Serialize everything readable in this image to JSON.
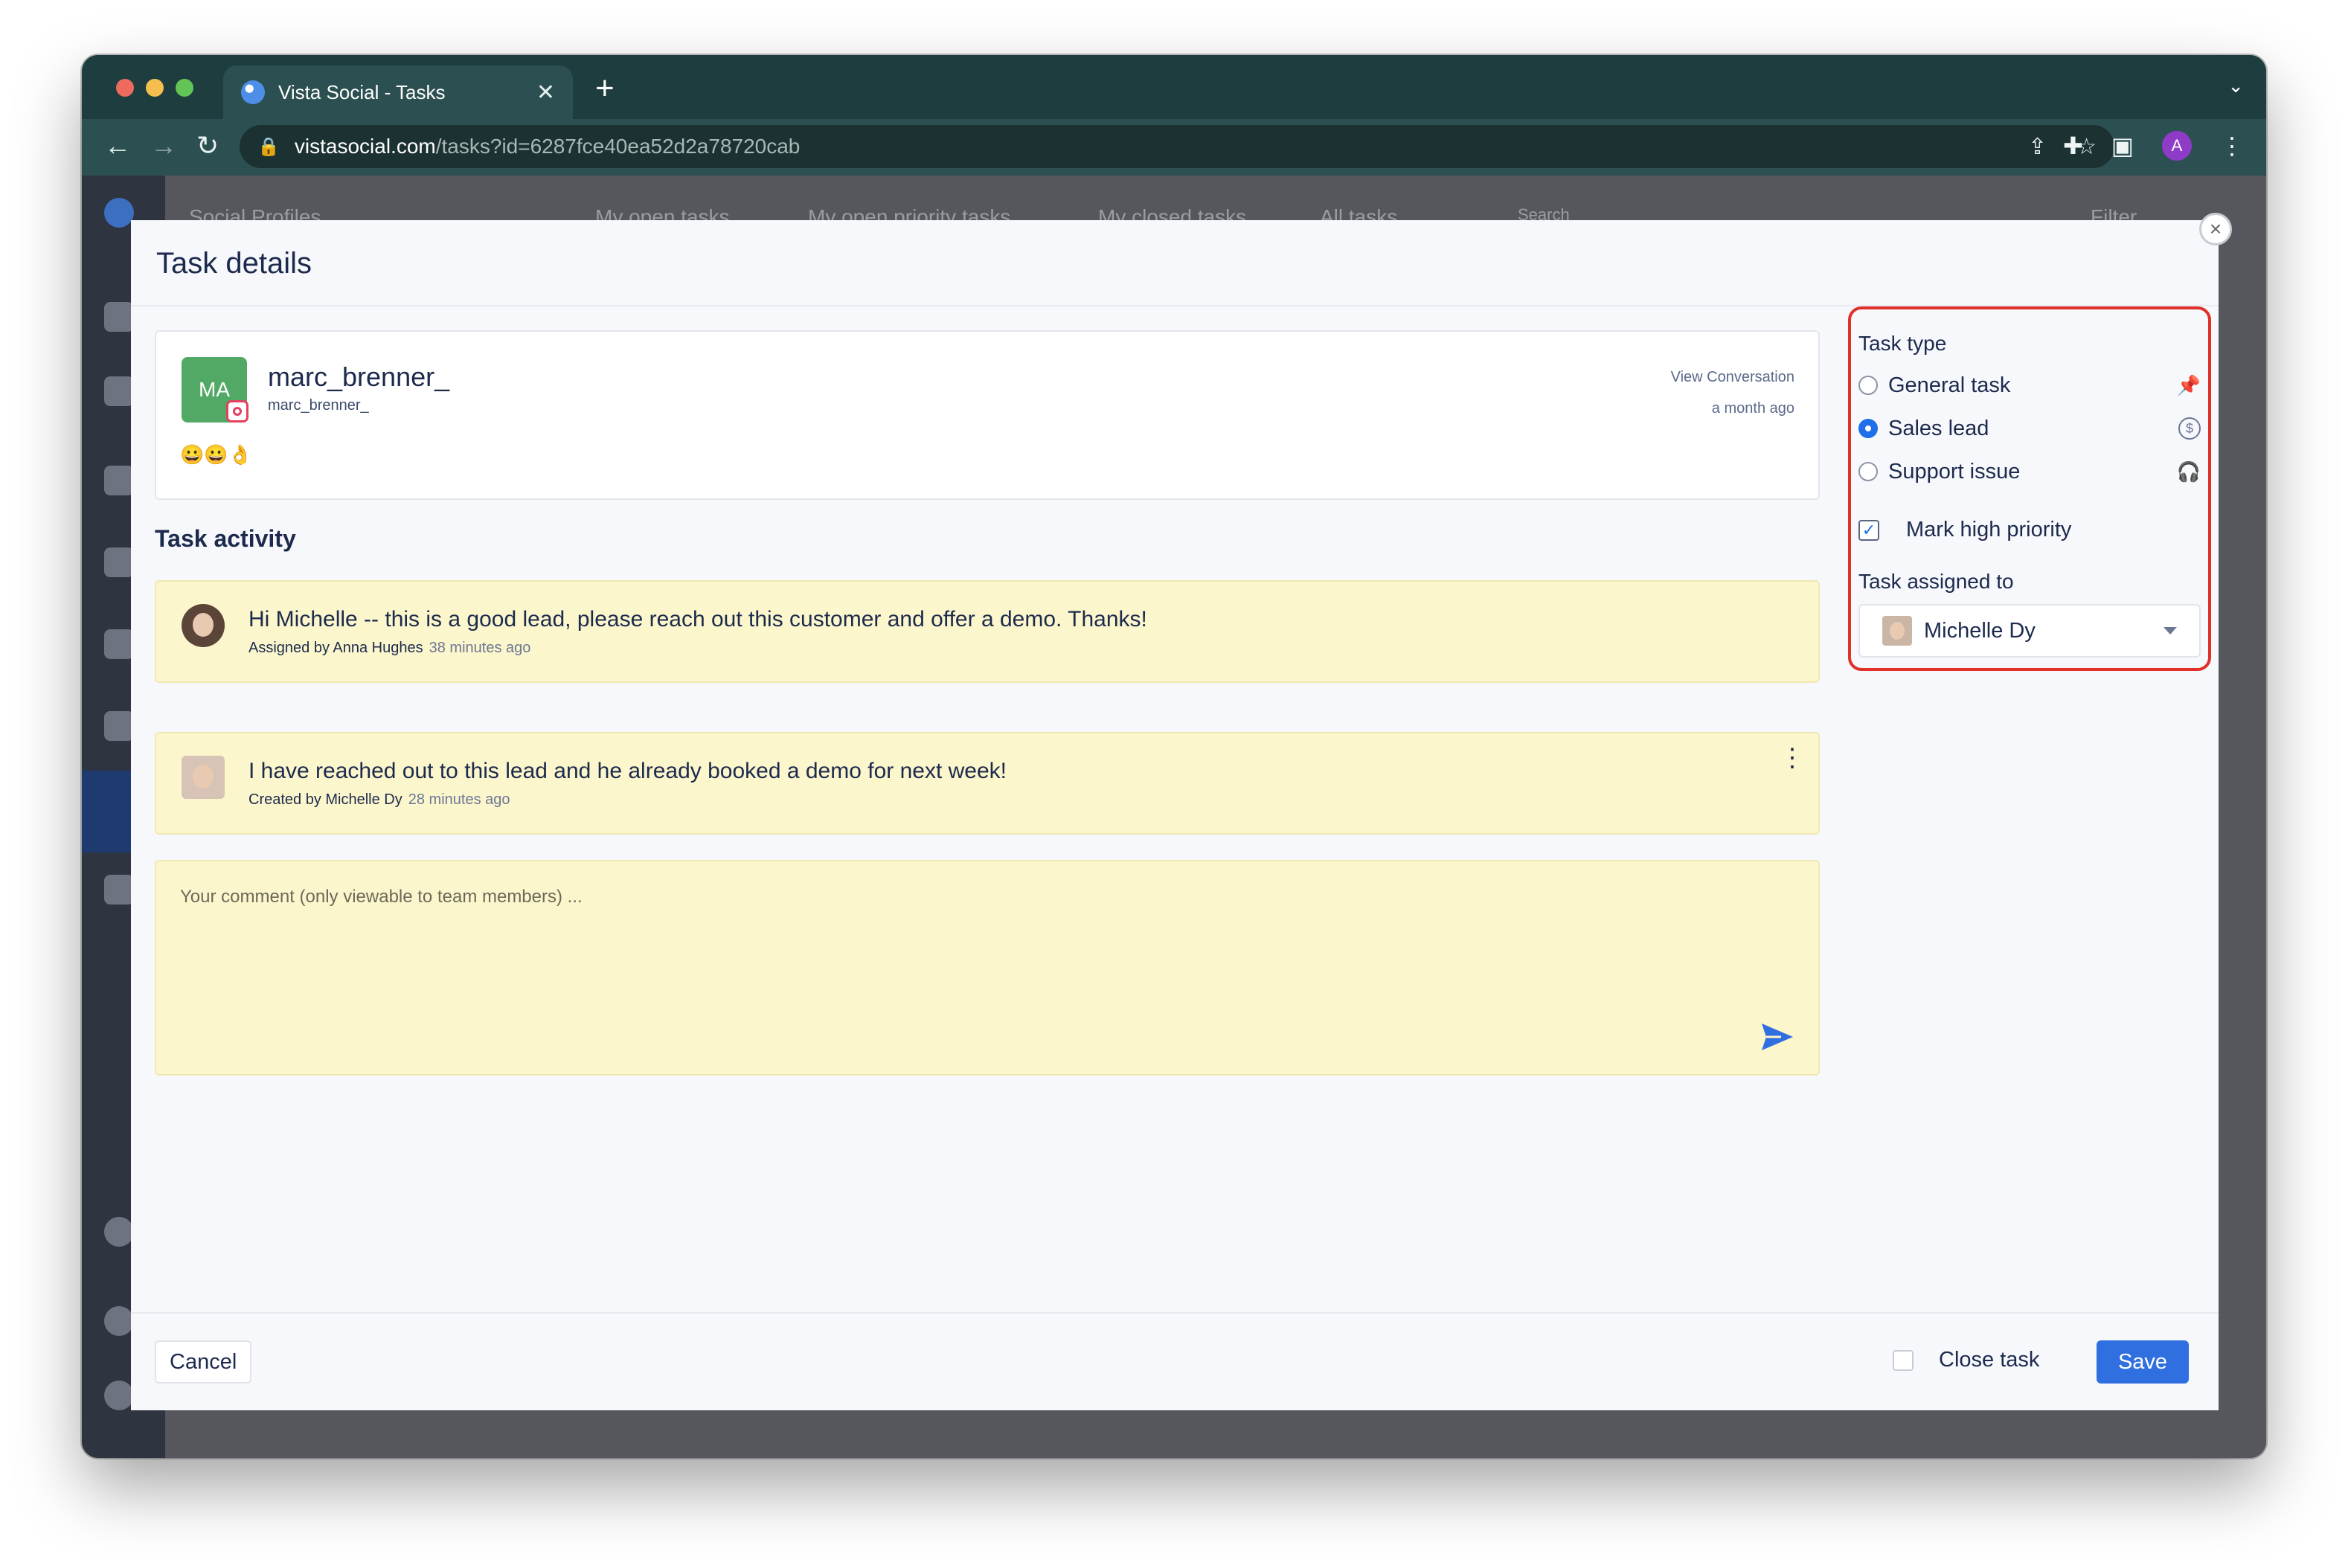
{
  "browser": {
    "tab_title": "Vista Social - Tasks",
    "tab_close": "✕",
    "new_tab": "+",
    "url_host": "vistasocial.com",
    "url_path": "/tasks?id=6287fce40ea52d2a78720cab",
    "profile_initial": "A"
  },
  "background": {
    "section_title": "Social Profiles",
    "tabs": [
      "My open tasks",
      "My open priority tasks",
      "My closed tasks",
      "All tasks"
    ],
    "search_placeholder": "Search",
    "filter_label": "Filter"
  },
  "modal": {
    "title": "Task details",
    "close_label": "×"
  },
  "post": {
    "avatar_initials": "MA",
    "name": "marc_brenner_",
    "handle": "marc_brenner_",
    "content": "😀😀👌",
    "view_conversation": "View Conversation",
    "time": "a month ago"
  },
  "activity": {
    "title": "Task activity",
    "comments": [
      {
        "text": "Hi Michelle -- this is a good lead, please reach out this customer and offer a demo. Thanks!",
        "meta": "Assigned by Anna Hughes",
        "time": "38 minutes ago"
      },
      {
        "text": "I have reached out to this lead and he already booked a demo for next week!",
        "meta": "Created by Michelle Dy",
        "time": "28 minutes ago"
      }
    ],
    "comment_placeholder": "Your comment (only viewable to team members) ..."
  },
  "task_panel": {
    "type_label": "Task type",
    "options": [
      {
        "label": "General task",
        "selected": false,
        "icon": "pin-icon"
      },
      {
        "label": "Sales lead",
        "selected": true,
        "icon": "dollar-circle-icon"
      },
      {
        "label": "Support issue",
        "selected": false,
        "icon": "headset-icon"
      }
    ],
    "high_priority_label": "Mark high priority",
    "high_priority_checked": true,
    "assigned_label": "Task assigned to",
    "assignee": "Michelle Dy"
  },
  "footer": {
    "cancel": "Cancel",
    "close_task": "Close task",
    "save": "Save"
  },
  "colors": {
    "accent": "#2f6fe0",
    "highlight_border": "#e0302a",
    "comment_bg": "#fcf6cc"
  }
}
